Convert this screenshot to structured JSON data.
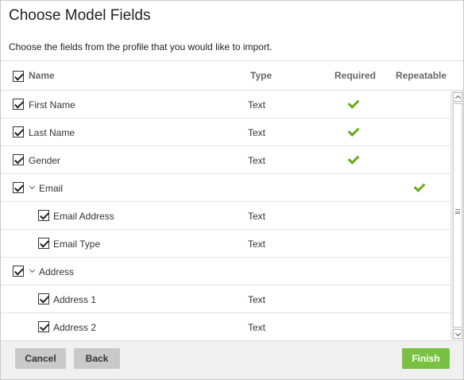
{
  "dialog": {
    "title": "Choose Model Fields",
    "subtitle": "Choose the fields from the profile that you would like to import."
  },
  "columns": {
    "name": "Name",
    "type": "Type",
    "required": "Required",
    "repeatable": "Repeatable"
  },
  "rows": [
    {
      "label": "First Name",
      "type": "Text",
      "checked": true,
      "required": true,
      "repeatable": false,
      "indent": 0,
      "expandable": false
    },
    {
      "label": "Last Name",
      "type": "Text",
      "checked": true,
      "required": true,
      "repeatable": false,
      "indent": 0,
      "expandable": false
    },
    {
      "label": "Gender",
      "type": "Text",
      "checked": true,
      "required": true,
      "repeatable": false,
      "indent": 0,
      "expandable": false
    },
    {
      "label": "Email",
      "type": "",
      "checked": true,
      "required": false,
      "repeatable": true,
      "indent": 0,
      "expandable": true
    },
    {
      "label": "Email Address",
      "type": "Text",
      "checked": true,
      "required": false,
      "repeatable": false,
      "indent": 1,
      "expandable": false
    },
    {
      "label": "Email Type",
      "type": "Text",
      "checked": true,
      "required": false,
      "repeatable": false,
      "indent": 1,
      "expandable": false
    },
    {
      "label": "Address",
      "type": "",
      "checked": true,
      "required": false,
      "repeatable": false,
      "indent": 0,
      "expandable": true
    },
    {
      "label": "Address 1",
      "type": "Text",
      "checked": true,
      "required": false,
      "repeatable": false,
      "indent": 1,
      "expandable": false
    },
    {
      "label": "Address 2",
      "type": "Text",
      "checked": true,
      "required": false,
      "repeatable": false,
      "indent": 1,
      "expandable": false
    }
  ],
  "footer": {
    "cancel": "Cancel",
    "back": "Back",
    "finish": "Finish"
  },
  "colors": {
    "check_green": "#6aaa1e",
    "finish_button": "#7ac143",
    "secondary_button": "#c9c9c9"
  },
  "icons": {
    "required": "checkmark-icon",
    "repeatable": "checkmark-icon",
    "expand": "chevron-down-icon"
  }
}
